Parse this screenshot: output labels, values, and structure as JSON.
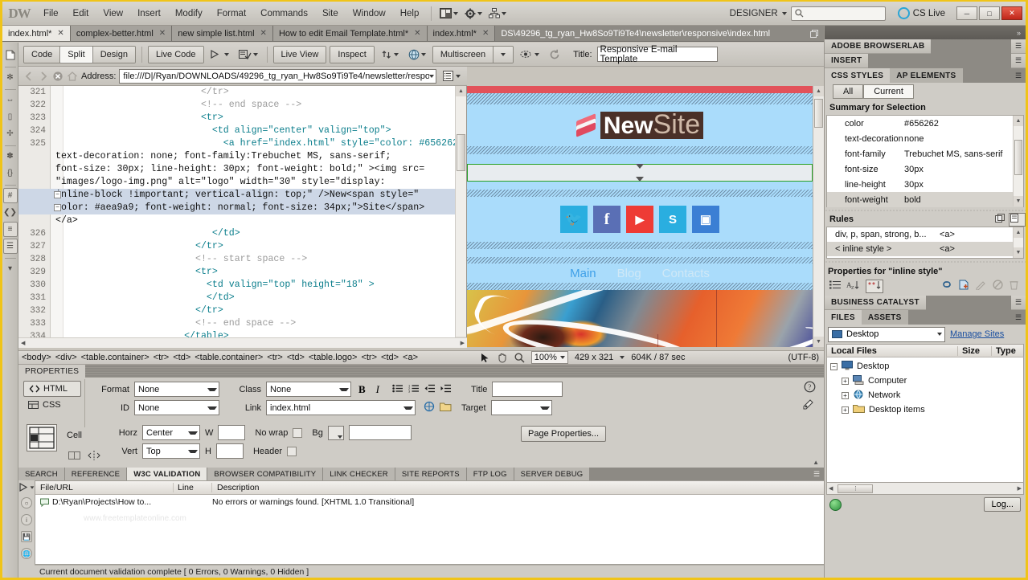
{
  "app": {
    "logo": "DW",
    "menus": [
      "File",
      "Edit",
      "View",
      "Insert",
      "Modify",
      "Format",
      "Commands",
      "Site",
      "Window",
      "Help"
    ],
    "workspace": "DESIGNER",
    "cslive": "CS Live",
    "search_placeholder": ""
  },
  "doc_tabs": [
    {
      "label": "index.html*",
      "active": true
    },
    {
      "label": "complex-better.html",
      "active": false
    },
    {
      "label": "new simple list.html",
      "active": false
    },
    {
      "label": "How to edit Email Template.html*",
      "active": false
    },
    {
      "label": "index.html*",
      "active": false
    }
  ],
  "doc_path": "DS\\49296_tg_ryan_Hw8So9Ti9Te4\\newsletter\\responsive\\index.html",
  "toolbar": {
    "view_modes": [
      "Code",
      "Split",
      "Design"
    ],
    "active_view": "Split",
    "live_code": "Live Code",
    "live_view": "Live View",
    "inspect": "Inspect",
    "multiscreen": "Multiscreen",
    "title_label": "Title:",
    "title_value": "Responsive E-mail Template",
    "address_label": "Address:",
    "address_value": "file:///D|/Ryan/DOWNLOADS/49296_tg_ryan_Hw8So9Ti9Te4/newsletter/respo"
  },
  "code": {
    "lines": [
      {
        "num": "321",
        "text": "                        </tr>",
        "cls": "cmt",
        "cont": false,
        "sel": false,
        "clip": true
      },
      {
        "num": "322",
        "text": "                        <!-- end space -->",
        "cls": "cmt",
        "cont": false,
        "sel": false
      },
      {
        "num": "323",
        "text": "                        <tr>",
        "cls": "tag",
        "cont": false,
        "sel": false
      },
      {
        "num": "324",
        "text": "                          <td align=\"center\" valign=\"top\">",
        "cls": "tag",
        "cont": false,
        "sel": false
      },
      {
        "num": "325",
        "text": "                            <a href=\"index.html\" style=\"color: #656262;",
        "cls": "tag",
        "cont": false,
        "sel": false
      },
      {
        "num": "",
        "text": "text-decoration: none; font-family:Trebuchet MS, sans-serif;",
        "cls": "plain",
        "cont": true,
        "sel": false
      },
      {
        "num": "",
        "text": "font-size: 30px; line-height: 30px; font-weight: bold;\" ><img src=",
        "cls": "plain",
        "cont": true,
        "sel": false
      },
      {
        "num": "",
        "text": "\"images/logo-img.png\" alt=\"logo\" width=\"30\" style=\"display:",
        "cls": "plain",
        "cont": true,
        "sel": false
      },
      {
        "num": "",
        "text": "inline-block !important; vertical-align: top;\" />New<span style=\"",
        "cls": "plain",
        "cont": true,
        "sel": true,
        "fold": true
      },
      {
        "num": "",
        "text": "color: #aea9a9; font-weight: normal; font-size: 34px;\">Site</span>",
        "cls": "plain",
        "cont": true,
        "sel": true,
        "fold": true
      },
      {
        "num": "",
        "text": "</a>",
        "cls": "plain",
        "cont": true,
        "sel": false
      },
      {
        "num": "326",
        "text": "                          </td>",
        "cls": "tag",
        "cont": false,
        "sel": false
      },
      {
        "num": "327",
        "text": "                       </tr>",
        "cls": "tag",
        "cont": false,
        "sel": false
      },
      {
        "num": "328",
        "text": "                       <!-- start space -->",
        "cls": "cmt",
        "cont": false,
        "sel": false
      },
      {
        "num": "329",
        "text": "                       <tr>",
        "cls": "tag",
        "cont": false,
        "sel": false
      },
      {
        "num": "330",
        "text": "                         <td valign=\"top\" height=\"18\" >",
        "cls": "tag",
        "cont": false,
        "sel": false
      },
      {
        "num": "331",
        "text": "                         </td>",
        "cls": "tag",
        "cont": false,
        "sel": false
      },
      {
        "num": "332",
        "text": "                       </tr>",
        "cls": "tag",
        "cont": false,
        "sel": false
      },
      {
        "num": "333",
        "text": "                       <!-- end space -->",
        "cls": "cmt",
        "cont": false,
        "sel": false
      },
      {
        "num": "334",
        "text": "                     </table>",
        "cls": "tag",
        "cont": false,
        "sel": false,
        "clip": true
      }
    ]
  },
  "design": {
    "logo_new": "New",
    "logo_site": "Site",
    "social": [
      {
        "name": "twitter-icon",
        "glyph": "ᵥ",
        "color": "#2aaee0"
      },
      {
        "name": "facebook-icon",
        "glyph": "f",
        "color": "#5a6fb5"
      },
      {
        "name": "youtube-icon",
        "glyph": "▶",
        "color": "#ee3b35"
      },
      {
        "name": "skype-icon",
        "glyph": "S",
        "color": "#2aaee0"
      },
      {
        "name": "instagram-icon",
        "glyph": "▣",
        "color": "#3b7fd4"
      }
    ],
    "nav": [
      "Main",
      "Blog",
      "Contacts"
    ]
  },
  "status": {
    "tag_selector": [
      "<body>",
      "<div>",
      "<table.container>",
      "<tr>",
      "<td>",
      "<table.container>",
      "<tr>",
      "<td>",
      "<table.logo>",
      "<tr>",
      "<td>",
      "<a>"
    ],
    "zoom": "100%",
    "window_size": "429 x 321",
    "download": "604K / 87 sec",
    "encoding": "(UTF-8)"
  },
  "properties": {
    "panel_title": "PROPERTIES",
    "html_btn": "HTML",
    "css_btn": "CSS",
    "format_label": "Format",
    "format_value": "None",
    "id_label": "ID",
    "id_value": "None",
    "class_label": "Class",
    "class_value": "None",
    "link_label": "Link",
    "link_value": "index.html",
    "title_label": "Title",
    "title_value": "",
    "target_label": "Target",
    "target_value": "",
    "cell_label": "Cell",
    "horz_label": "Horz",
    "horz_value": "Center",
    "vert_label": "Vert",
    "vert_value": "Top",
    "w_label": "W",
    "w_value": "",
    "h_label": "H",
    "h_value": "",
    "nowrap_label": "No wrap",
    "header_label": "Header",
    "bg_label": "Bg",
    "bg_value": "",
    "page_properties_btn": "Page Properties..."
  },
  "results": {
    "tabs": [
      "SEARCH",
      "REFERENCE",
      "W3C VALIDATION",
      "BROWSER COMPATIBILITY",
      "LINK CHECKER",
      "SITE REPORTS",
      "FTP LOG",
      "SERVER DEBUG"
    ],
    "active_tab": "W3C VALIDATION",
    "columns": [
      "File/URL",
      "Line",
      "Description"
    ],
    "rows": [
      {
        "file": "D:\\Ryan\\Projects\\How to...",
        "line": "",
        "description": "No errors or warnings found. [XHTML 1.0 Transitional]"
      }
    ],
    "watermark": "www.freetemplateonline.com",
    "status": "Current document validation complete [ 0 Errors, 0 Warnings, 0 Hidden ]"
  },
  "right_dock": {
    "browserlab": "ADOBE BROWSERLAB",
    "insert": "INSERT",
    "css_tabs": [
      {
        "label": "CSS STYLES",
        "active": true
      },
      {
        "label": "AP ELEMENTS",
        "active": false
      }
    ],
    "filter": [
      {
        "label": "All",
        "active": false
      },
      {
        "label": "Current",
        "active": true
      }
    ],
    "summary_title": "Summary for Selection",
    "summary": [
      {
        "prop": "color",
        "value": "#656262",
        "sel": false
      },
      {
        "prop": "text-decoration",
        "value": "none",
        "sel": false
      },
      {
        "prop": "font-family",
        "value": "Trebuchet MS, sans-serif",
        "sel": false
      },
      {
        "prop": "font-size",
        "value": "30px",
        "sel": false
      },
      {
        "prop": "line-height",
        "value": "30px",
        "sel": false
      },
      {
        "prop": "font-weight",
        "value": "bold",
        "sel": true
      }
    ],
    "rules_title": "Rules",
    "rules": [
      {
        "selector": "div, p, span, strong, b...",
        "applies": "<a>",
        "sel": false
      },
      {
        "selector": "< inline style >",
        "applies": "<a>",
        "sel": true
      }
    ],
    "properties_for": "Properties for \"inline style\"",
    "business_catalyst": "BUSINESS CATALYST",
    "files_tabs": [
      {
        "label": "FILES",
        "active": true
      },
      {
        "label": "ASSETS",
        "active": false
      }
    ],
    "site_select": "Desktop",
    "manage_sites": "Manage Sites",
    "files_columns": [
      "Local Files",
      "Size",
      "Type"
    ],
    "files_tree": [
      {
        "label": "Desktop",
        "indent": 0,
        "expander": "−",
        "icon": "monitor-icon"
      },
      {
        "label": "Computer",
        "indent": 1,
        "expander": "+",
        "icon": "computer-icon"
      },
      {
        "label": "Network",
        "indent": 1,
        "expander": "+",
        "icon": "network-icon"
      },
      {
        "label": "Desktop items",
        "indent": 1,
        "expander": "+",
        "icon": "folder-icon"
      }
    ],
    "log_btn": "Log..."
  },
  "colors": {
    "accent_yellow": "#f0c419",
    "chrome_gray": "#cfccc6",
    "dock_dark": "#8d8a84",
    "link_blue": "#1a4fa0"
  }
}
